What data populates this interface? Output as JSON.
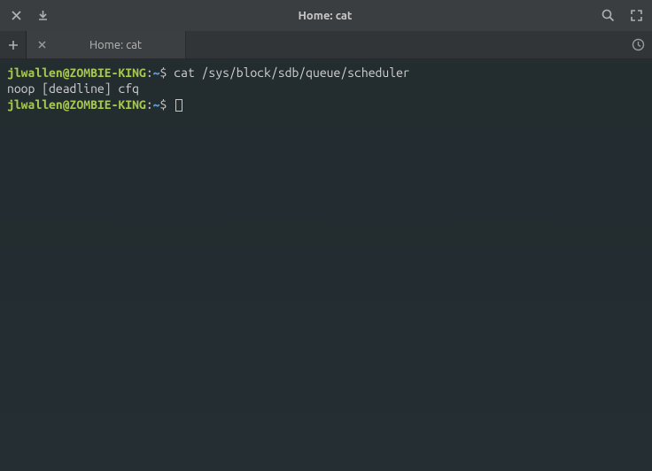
{
  "window": {
    "title": "Home: cat"
  },
  "tab": {
    "label": "Home: cat"
  },
  "terminal": {
    "prompt_user_host": "jlwallen@ZOMBIE-KING",
    "prompt_sep": ":",
    "prompt_path": "~",
    "prompt_symbol": "$",
    "lines": [
      {
        "command": "cat /sys/block/sdb/queue/scheduler"
      },
      {
        "output": "noop [deadline] cfq"
      },
      {
        "command": ""
      }
    ]
  }
}
